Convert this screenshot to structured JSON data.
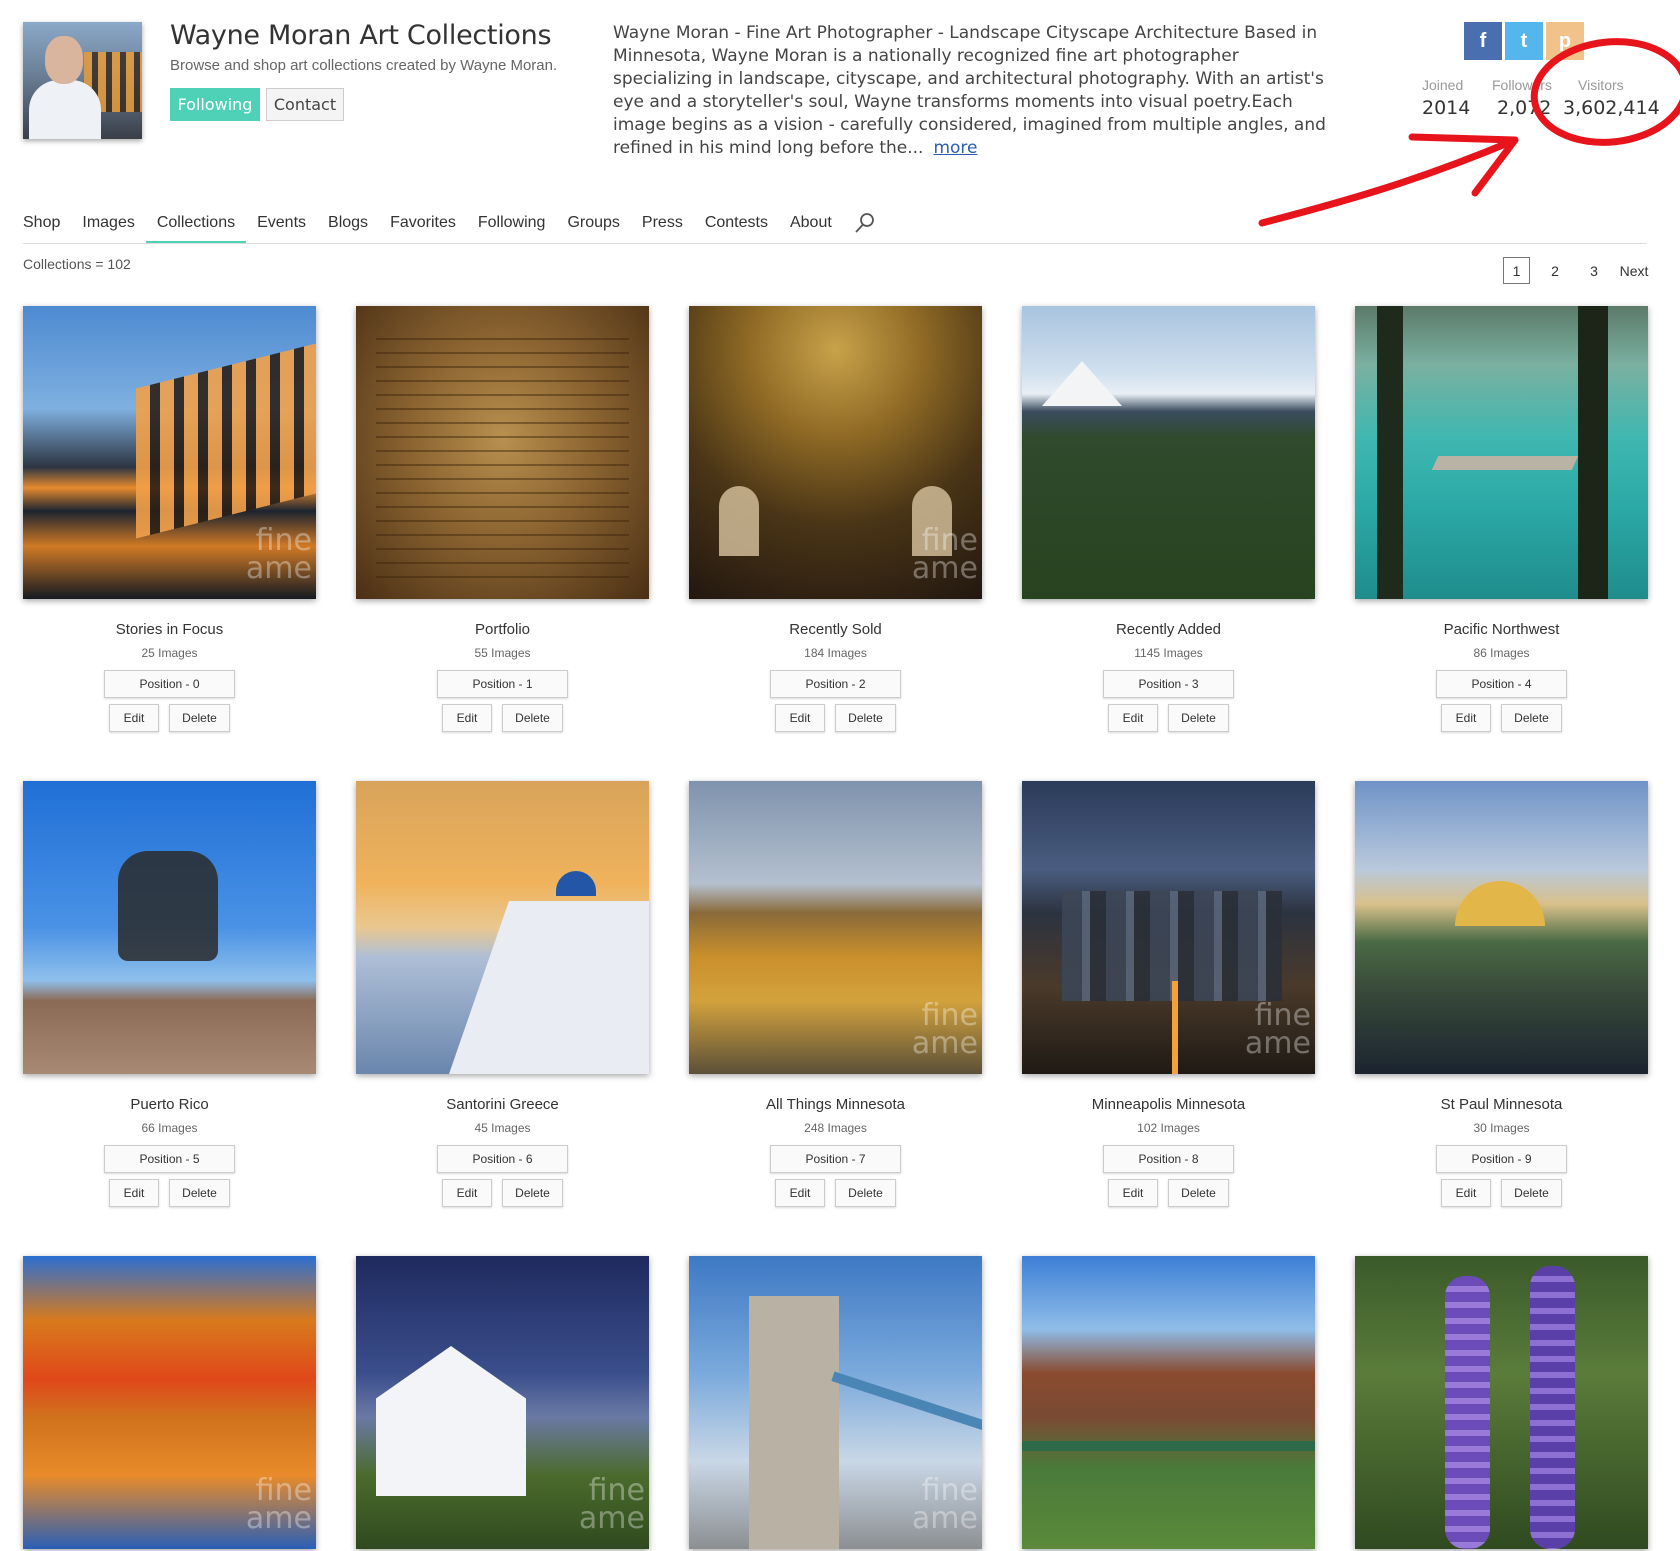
{
  "header": {
    "title": "Wayne Moran Art Collections",
    "subtitle": "Browse and shop art collections created by Wayne Moran.",
    "following_label": "Following",
    "contact_label": "Contact",
    "bio": "Wayne Moran - Fine Art Photographer - Landscape Cityscape Architecture Based in Minnesota, Wayne Moran is a nationally recognized fine art photographer specializing in landscape, cityscape, and architectural photography.  With an artist's eye and a storyteller's soul, Wayne transforms moments into visual poetry.Each image begins as a vision - carefully considered, imagined from multiple angles, and refined in his mind long before the...",
    "more_label": "more",
    "social": {
      "fb": "f",
      "tw": "t",
      "pi": "p"
    },
    "stats": [
      {
        "label": "Joined",
        "value": "2014"
      },
      {
        "label": "Followers",
        "value": "2,072"
      },
      {
        "label": "Visitors",
        "value": "3,602,414"
      }
    ]
  },
  "nav": {
    "items": [
      "Shop",
      "Images",
      "Collections",
      "Events",
      "Blogs",
      "Favorites",
      "Following",
      "Groups",
      "Press",
      "Contests",
      "About"
    ],
    "active": "Collections"
  },
  "listing": {
    "count_text": "Collections = 102",
    "pages": [
      "1",
      "2",
      "3"
    ],
    "next_label": "Next",
    "edit_label": "Edit",
    "delete_label": "Delete",
    "watermark": "fine\name"
  },
  "collections": [
    {
      "title": "Stories in Focus",
      "count": "25 Images",
      "position": "Position - 0"
    },
    {
      "title": "Portfolio",
      "count": "55 Images",
      "position": "Position - 1"
    },
    {
      "title": "Recently Sold",
      "count": "184 Images",
      "position": "Position - 2"
    },
    {
      "title": "Recently Added",
      "count": "1145 Images",
      "position": "Position - 3"
    },
    {
      "title": "Pacific Northwest",
      "count": "86 Images",
      "position": "Position - 4"
    },
    {
      "title": "Puerto Rico",
      "count": "66 Images",
      "position": "Position - 5"
    },
    {
      "title": "Santorini Greece",
      "count": "45 Images",
      "position": "Position - 6"
    },
    {
      "title": "All Things Minnesota",
      "count": "248 Images",
      "position": "Position - 7"
    },
    {
      "title": "Minneapolis Minnesota",
      "count": "102 Images",
      "position": "Position - 8"
    },
    {
      "title": "St Paul Minnesota",
      "count": "30 Images",
      "position": "Position - 9"
    }
  ],
  "colors": {
    "accent": "#4fd1b8",
    "annotation": "#e8141b"
  }
}
